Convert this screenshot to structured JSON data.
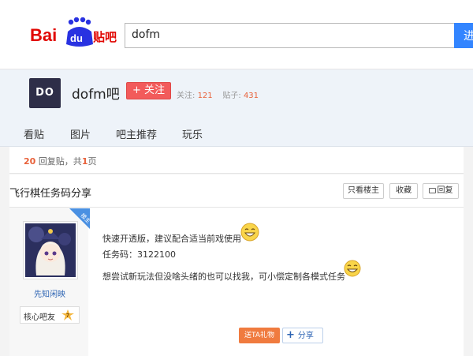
{
  "brand": {
    "logo_text_left": "Bai",
    "logo_text_du": "du",
    "logo_text_right": "贴吧"
  },
  "search": {
    "value": "dofm",
    "button_label": "进"
  },
  "forum": {
    "avatar_text": "DO",
    "name": "dofm吧",
    "follow_label": "+ 关注",
    "followers_label": "关注:",
    "followers_count": "121",
    "posts_label": "贴子:",
    "posts_count": "431"
  },
  "nav": {
    "items": [
      "看贴",
      "图片",
      "吧主推荐",
      "玩乐"
    ]
  },
  "reply_info": {
    "count": "20",
    "middle": "回复贴，共",
    "pages": "1",
    "suffix": "页"
  },
  "thread": {
    "title": "飞行棋任务码分享",
    "buttons": {
      "only_op": "只看楼主",
      "favorite": "收藏",
      "reply": "回复"
    }
  },
  "post": {
    "badge": "楼主",
    "username": "先知闲映",
    "level_label": "核心吧友",
    "level_number": "7",
    "lines": [
      "快速开透版，建议配合适当前戏使用",
      "任务码：3122100",
      "想尝试新玩法但没啥头绪的也可以找我，可小偿定制各模式任务"
    ],
    "gift_label": "送TA礼物",
    "share_label": "分享"
  },
  "colors": {
    "accent_blue": "#3385ff",
    "follow_red": "#f25b5b",
    "count_orange": "#e8613a",
    "link_blue": "#2d64b3"
  }
}
